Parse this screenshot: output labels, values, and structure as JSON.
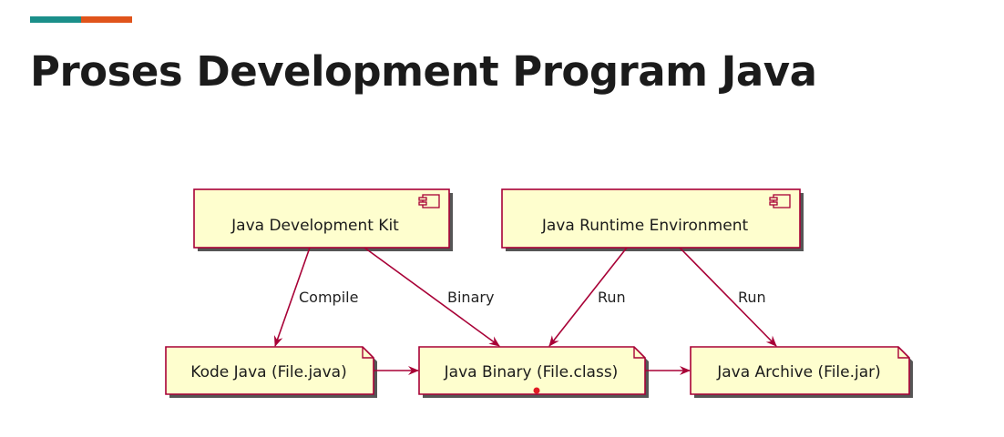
{
  "slide": {
    "title": "Proses Development Program Java"
  },
  "colors": {
    "accent_teal": "#1a8f8a",
    "accent_orange": "#e0541b",
    "node_fill": "#fefece",
    "node_border": "#a80036",
    "arrow": "#a80036",
    "shadow": "#555555"
  },
  "diagram": {
    "components": [
      {
        "id": "jdk",
        "label": "Java Development Kit",
        "icon": "component-icon"
      },
      {
        "id": "jre",
        "label": "Java Runtime Environment",
        "icon": "component-icon"
      }
    ],
    "artifacts": [
      {
        "id": "kode",
        "label": "Kode Java (File.java)"
      },
      {
        "id": "binary",
        "label": "Java Binary (File.class)"
      },
      {
        "id": "archive",
        "label": "Java Archive (File.jar)"
      }
    ],
    "edges": [
      {
        "from": "jdk",
        "to": "kode",
        "label": "Compile"
      },
      {
        "from": "jdk",
        "to": "binary",
        "label": "Binary"
      },
      {
        "from": "jre",
        "to": "binary",
        "label": "Run"
      },
      {
        "from": "jre",
        "to": "archive",
        "label": "Run"
      },
      {
        "from": "kode",
        "to": "binary",
        "label": ""
      },
      {
        "from": "binary",
        "to": "archive",
        "label": ""
      }
    ]
  }
}
